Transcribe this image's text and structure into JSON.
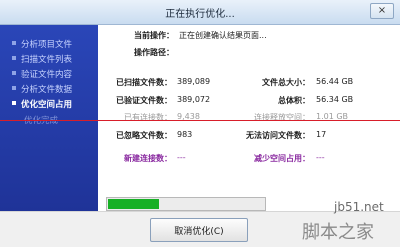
{
  "window": {
    "title": "正在执行优化...",
    "close_label": "×"
  },
  "sidebar": {
    "items": [
      {
        "label": "分析项目文件",
        "state": "done"
      },
      {
        "label": "扫描文件列表",
        "state": "done"
      },
      {
        "label": "验证文件内容",
        "state": "done"
      },
      {
        "label": "分析文件数据",
        "state": "done"
      },
      {
        "label": "优化空间占用",
        "state": "active"
      },
      {
        "label": "优化完成",
        "state": "pending"
      }
    ]
  },
  "current": {
    "op_label": "当前操作：",
    "op_value": "正在创建确认结果页面...",
    "path_label": "操作路径：",
    "path_value": ""
  },
  "stats": {
    "scanned_label": "已扫描文件数：",
    "scanned_value": "389,089",
    "total_size_label": "文件总大小：",
    "total_size_value": "56.44 GB",
    "verified_label": "已验证文件数：",
    "verified_value": "389,072",
    "total_vol_label": "总体积：",
    "total_vol_value": "56.34 GB",
    "links_label": "已有连接数：",
    "links_value": "9,438",
    "reclaim_label": "连接释放空间：",
    "reclaim_value": "1.01 GB",
    "ignored_label": "已忽略文件数：",
    "ignored_value": "983",
    "noaccess_label": "无法访问文件数：",
    "noaccess_value": "17",
    "new_links_label": "新建连接数：",
    "new_links_value": "---",
    "reduce_label": "减少空间占用：",
    "reduce_value": "---"
  },
  "progress": {
    "fraction": 0.33
  },
  "buttons": {
    "cancel_label": "取消优化(C)"
  },
  "watermark": {
    "site": "jb51.net",
    "brand": "脚本之家"
  },
  "colors": {
    "sidebar": "#2a46b8",
    "progress": "#17b025",
    "accent_text": "#8a2aa0",
    "divider": "#d81e2a"
  }
}
